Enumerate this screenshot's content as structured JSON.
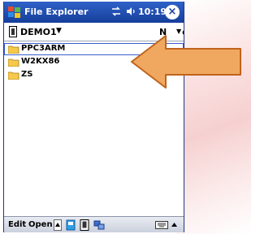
{
  "titlebar": {
    "title": "File Explorer",
    "time": "10:19",
    "close_glyph": "×",
    "icons": [
      "windows-start-icon",
      "connectivity-icon",
      "volume-icon",
      "close-icon"
    ]
  },
  "pathbar": {
    "location": "DEMO1",
    "sort_label": "N",
    "sort_label_visible_tail": "e"
  },
  "files": [
    {
      "name": "PPC3ARM",
      "selected": true
    },
    {
      "name": "W2KX86",
      "selected": false
    },
    {
      "name": "ZS",
      "selected": false
    }
  ],
  "menubar": {
    "edit_label": "Edit",
    "open_label": "Open"
  },
  "colors": {
    "titlebar": "#163e9a",
    "arrow_fill": "#f0a860",
    "arrow_stroke": "#c0631c",
    "folder": "#f6c94a"
  }
}
